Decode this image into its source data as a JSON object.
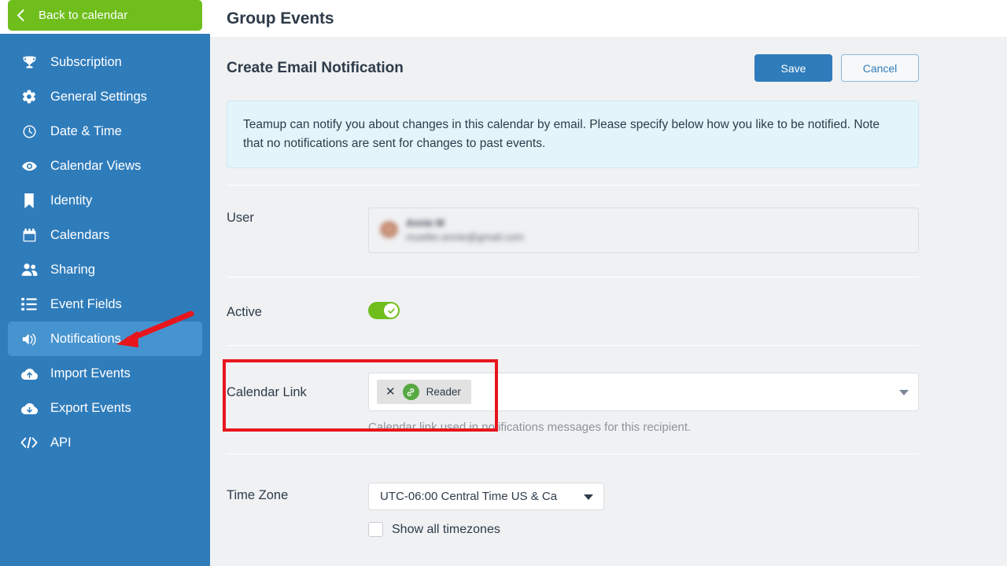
{
  "sidebar": {
    "back_button": {
      "label": "Back to calendar",
      "icon": "chevron-left-icon"
    },
    "items": [
      {
        "label": "Subscription",
        "icon": "trophy-icon",
        "active": false
      },
      {
        "label": "General Settings",
        "icon": "gear-icon",
        "active": false
      },
      {
        "label": "Date & Time",
        "icon": "clock-icon",
        "active": false
      },
      {
        "label": "Calendar Views",
        "icon": "eye-icon",
        "active": false
      },
      {
        "label": "Identity",
        "icon": "bookmark-icon",
        "active": false
      },
      {
        "label": "Calendars",
        "icon": "calendar-icon",
        "active": false
      },
      {
        "label": "Sharing",
        "icon": "users-icon",
        "active": false
      },
      {
        "label": "Event Fields",
        "icon": "list-icon",
        "active": false
      },
      {
        "label": "Notifications",
        "icon": "speaker-icon",
        "active": true
      },
      {
        "label": "Import Events",
        "icon": "cloud-upload-icon",
        "active": false
      },
      {
        "label": "Export Events",
        "icon": "cloud-download-icon",
        "active": false
      },
      {
        "label": "API",
        "icon": "code-icon",
        "active": false
      }
    ]
  },
  "header": {
    "title": "Group Events"
  },
  "page": {
    "title": "Create Email Notification",
    "save_label": "Save",
    "cancel_label": "Cancel",
    "info_text": "Teamup can notify you about changes in this calendar by email. Please specify below how you like to be notified. Note that no notifications are sent for changes to past events."
  },
  "form": {
    "user": {
      "label": "User",
      "name": "Annie M",
      "email": "mueller.annie@gmail.com"
    },
    "active": {
      "label": "Active",
      "value": "on",
      "toggle_icon": "check-icon"
    },
    "calendar_link": {
      "label": "Calendar Link",
      "tag_label": "Reader",
      "tag_remove_icon": "close-icon",
      "tag_type_icon": "link-icon",
      "dropdown_icon": "caret-down-icon",
      "hint": "Calendar link used in notifications messages for this recipient."
    },
    "time_zone": {
      "label": "Time Zone",
      "value": "UTC-06:00 Central Time US & Ca",
      "dropdown_icon": "caret-down-icon",
      "show_all_label": "Show all timezones",
      "show_all_checked": false
    }
  },
  "annotations": {
    "highlight_box_color": "#e8151c",
    "arrow_color": "#e8151c",
    "arrow_target": "sidebar-item-notifications"
  },
  "colors": {
    "sidebar_bg": "#2f7cbb",
    "sidebar_active": "#4593cf",
    "green": "#6fbe1c",
    "primary": "#2f7cbb",
    "info_bg": "#e3f4fb"
  }
}
